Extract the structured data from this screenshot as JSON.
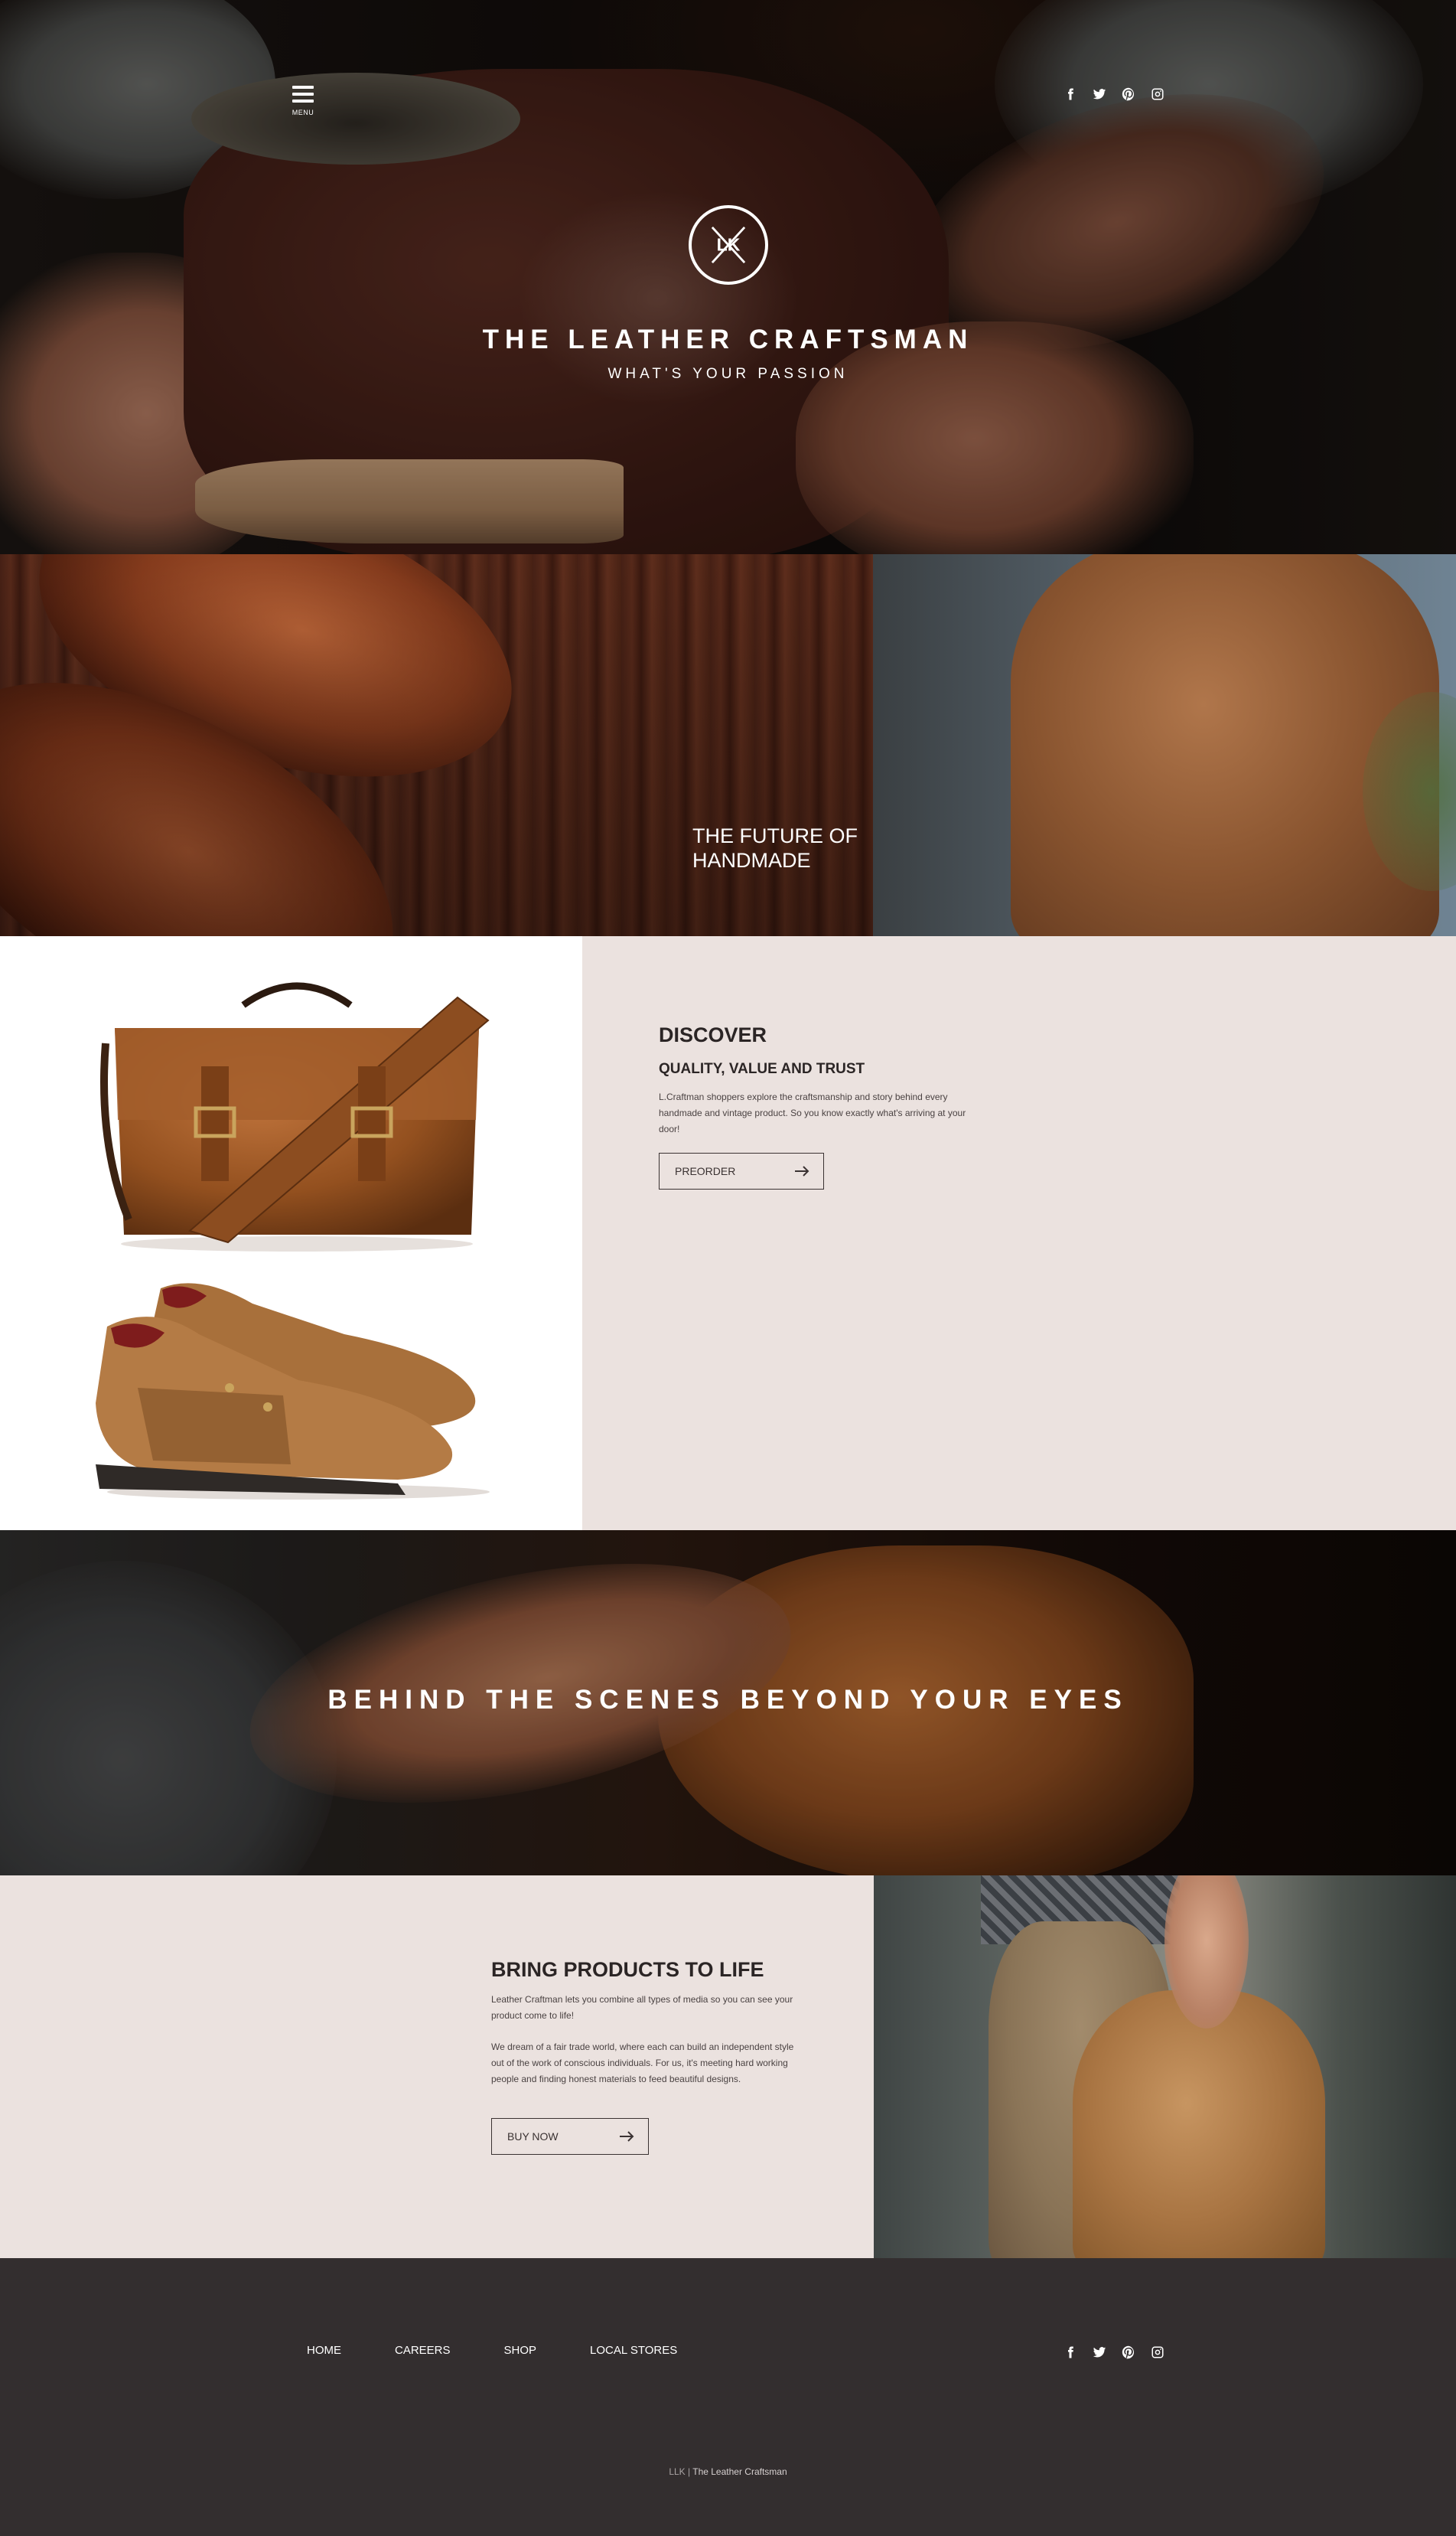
{
  "header": {
    "menu_label": "MENU",
    "social": [
      "facebook-icon",
      "twitter-icon",
      "pinterest-icon",
      "instagram-icon"
    ]
  },
  "hero": {
    "logo_text": "LK",
    "title": "THE LEATHER CRAFTSMAN",
    "subtitle": "WHAT'S YOUR PASSION"
  },
  "feature": {
    "caption_line1": "THE FUTURE OF",
    "caption_line2": "HANDMADE"
  },
  "discover": {
    "title": "DISCOVER",
    "subtitle": "QUALITY, VALUE AND TRUST",
    "body": "L.Craftman shoppers explore the craftsmanship and story behind every handmade and vintage product. So you know exactly what's arriving at your door!",
    "button_label": "PREORDER"
  },
  "scenes": {
    "title": "BEHIND THE SCENES BEYOND YOUR EYES"
  },
  "bring": {
    "title": "BRING PRODUCTS TO LIFE",
    "paragraph1": "Leather Craftman lets you combine all types of media so you can see your product come to life!",
    "paragraph2": "We dream of a fair trade world, where each can build an independent style out of the work of conscious individuals. For us, it's meeting hard working people and finding honest materials to feed beautiful designs.",
    "button_label": "BUY NOW"
  },
  "footer": {
    "nav": [
      "HOME",
      "CAREERS",
      "SHOP",
      "LOCAL STORES"
    ],
    "social": [
      "facebook-icon",
      "twitter-icon",
      "pinterest-icon",
      "instagram-icon"
    ],
    "copyright_prefix": "LLK | ",
    "copyright_name": "The Leather Craftsman"
  },
  "colors": {
    "panel_bg": "#ebe2df",
    "footer_bg": "#332e2f",
    "text_dark": "#2b2525"
  }
}
